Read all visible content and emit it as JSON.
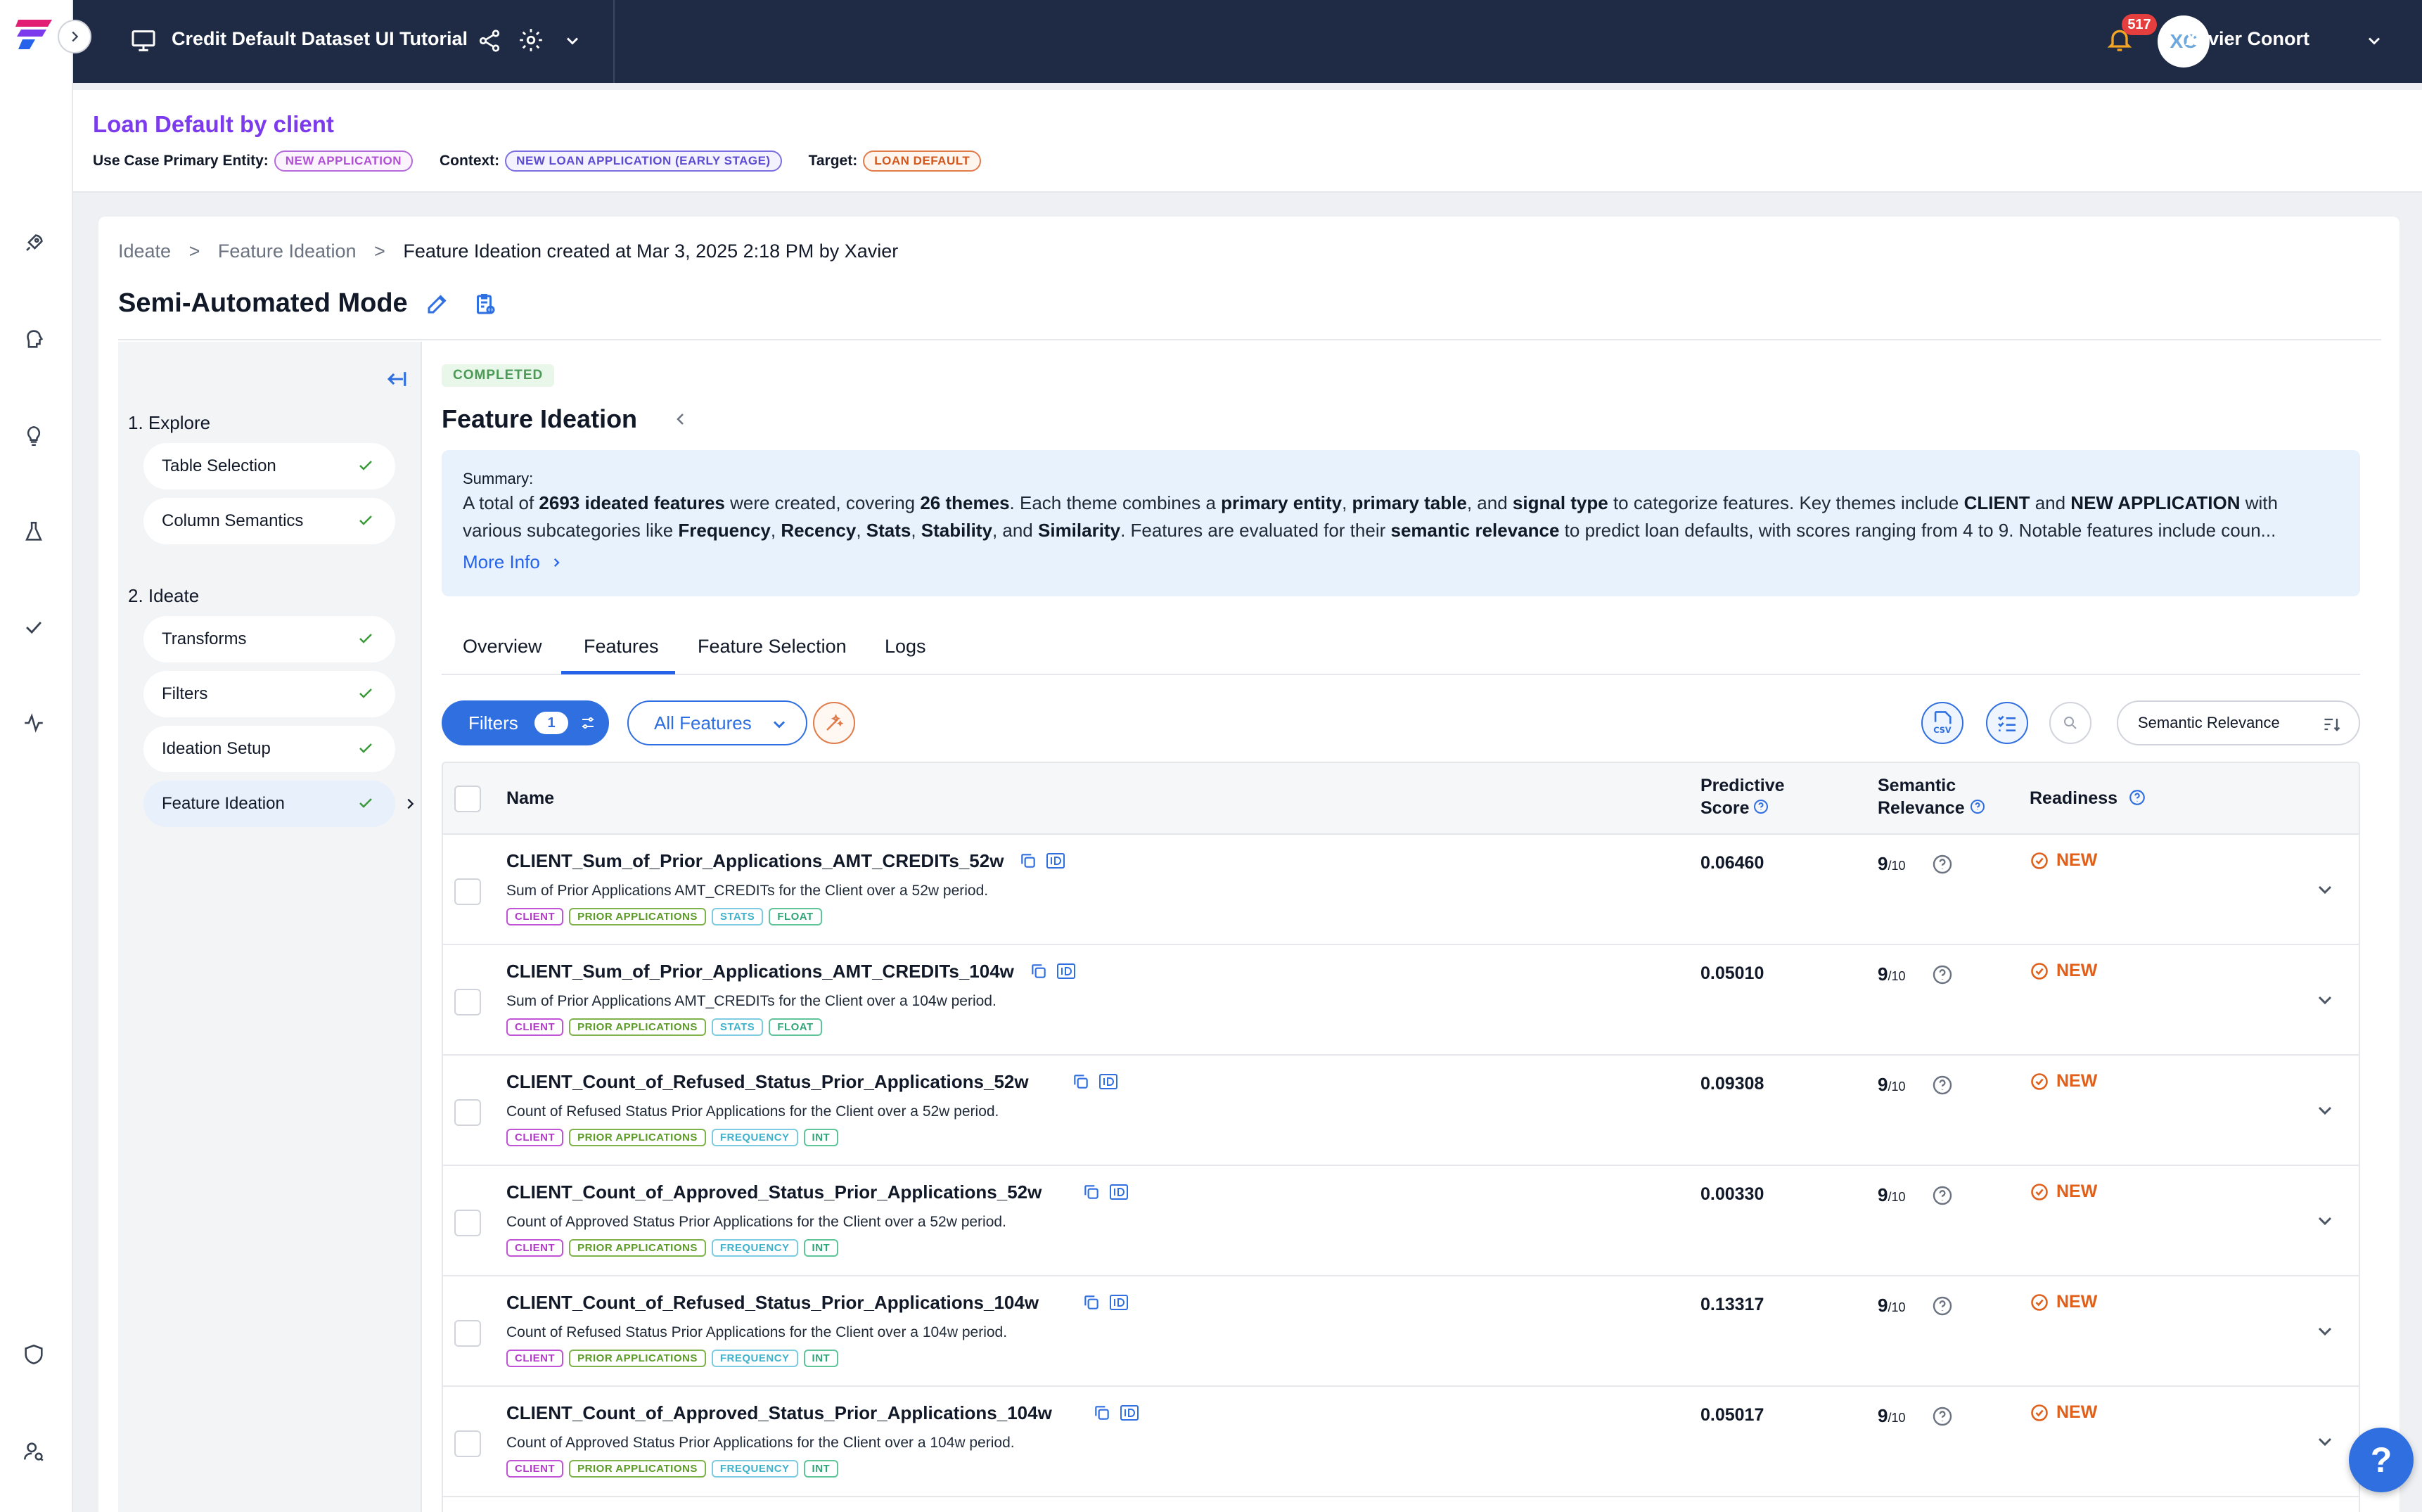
{
  "topbar": {
    "project_title": "Credit Default Dataset UI Tutorial",
    "notification_count": "517",
    "avatar_initials": "XC",
    "user_name": "Xavier Conort"
  },
  "use_case": {
    "title": "Loan Default by client",
    "entity_label": "Use Case Primary Entity:",
    "entity_value": "NEW APPLICATION",
    "context_label": "Context:",
    "context_value": "NEW LOAN APPLICATION (EARLY STAGE)",
    "target_label": "Target:",
    "target_value": "LOAN DEFAULT"
  },
  "breadcrumb": {
    "item1": "Ideate",
    "sep": ">",
    "item2": "Feature Ideation",
    "current": "Feature Ideation created at Mar 3, 2025 2:18 PM by Xavier"
  },
  "mode_title": "Semi-Automated Mode",
  "steps": {
    "explore_heading": "1. Explore",
    "ideate_heading": "2. Ideate",
    "items": [
      {
        "label": "Table Selection"
      },
      {
        "label": "Column Semantics"
      },
      {
        "label": "Transforms"
      },
      {
        "label": "Filters"
      },
      {
        "label": "Ideation Setup"
      },
      {
        "label": "Feature Ideation"
      }
    ]
  },
  "main": {
    "status": "COMPLETED",
    "title": "Feature Ideation",
    "summary_label": "Summary:",
    "summary": {
      "p1": "A total of ",
      "b1": "2693 ideated features",
      "p2": " were created, covering ",
      "b2": "26 themes",
      "p3": ". Each theme combines a ",
      "b3": "primary entity",
      "p4": ", ",
      "b4": "primary table",
      "p5": ", and ",
      "b5": "signal type",
      "p6": " to categorize features. Key themes include ",
      "b6": "CLIENT",
      "p7": " and ",
      "b7": "NEW APPLICATION",
      "p8": " with various subcategories like ",
      "b8": "Frequency",
      "p9": ", ",
      "b9": "Recency",
      "p10": ", ",
      "b10": "Stats",
      "p11": ", ",
      "b11": "Stability",
      "p12": ", and ",
      "b12": "Similarity",
      "p13": ". Features are evaluated for their ",
      "b13": "semantic relevance",
      "p14": " to predict loan defaults, with scores ranging from 4 to 9. Notable features include coun..."
    },
    "more_info": "More Info",
    "tabs": [
      "Overview",
      "Features",
      "Feature Selection",
      "Logs"
    ]
  },
  "toolbar": {
    "filters_label": "Filters",
    "filters_count": "1",
    "all_features": "All Features",
    "sort_label": "Semantic Relevance"
  },
  "table": {
    "headers": {
      "name": "Name",
      "predictive_1": "Predictive",
      "predictive_2": "Score",
      "semantic_1": "Semantic",
      "semantic_2": "Relevance",
      "readiness": "Readiness"
    },
    "rows": [
      {
        "name": "CLIENT_Sum_of_Prior_Applications_AMT_CREDITs_52w",
        "desc": "Sum of Prior Applications AMT_CREDITs for the Client over a 52w period.",
        "tags": [
          "CLIENT",
          "PRIOR APPLICATIONS",
          "STATS",
          "FLOAT"
        ],
        "score": "0.06460",
        "sem": "9",
        "sem_den": "/10",
        "ready": "NEW"
      },
      {
        "name": "CLIENT_Sum_of_Prior_Applications_AMT_CREDITs_104w",
        "desc": "Sum of Prior Applications AMT_CREDITs for the Client over a 104w period.",
        "tags": [
          "CLIENT",
          "PRIOR APPLICATIONS",
          "STATS",
          "FLOAT"
        ],
        "score": "0.05010",
        "sem": "9",
        "sem_den": "/10",
        "ready": "NEW"
      },
      {
        "name": "CLIENT_Count_of_Refused_Status_Prior_Applications_52w",
        "desc": "Count of Refused Status Prior Applications for the Client over a 52w period.",
        "tags": [
          "CLIENT",
          "PRIOR APPLICATIONS",
          "FREQUENCY",
          "INT"
        ],
        "score": "0.09308",
        "sem": "9",
        "sem_den": "/10",
        "ready": "NEW"
      },
      {
        "name": "CLIENT_Count_of_Approved_Status_Prior_Applications_52w",
        "desc": "Count of Approved Status Prior Applications for the Client over a 52w period.",
        "tags": [
          "CLIENT",
          "PRIOR APPLICATIONS",
          "FREQUENCY",
          "INT"
        ],
        "score": "0.00330",
        "sem": "9",
        "sem_den": "/10",
        "ready": "NEW"
      },
      {
        "name": "CLIENT_Count_of_Refused_Status_Prior_Applications_104w",
        "desc": "Count of Refused Status Prior Applications for the Client over a 104w period.",
        "tags": [
          "CLIENT",
          "PRIOR APPLICATIONS",
          "FREQUENCY",
          "INT"
        ],
        "score": "0.13317",
        "sem": "9",
        "sem_den": "/10",
        "ready": "NEW"
      },
      {
        "name": "CLIENT_Count_of_Approved_Status_Prior_Applications_104w",
        "desc": "Count of Approved Status Prior Applications for the Client over a 104w period.",
        "tags": [
          "CLIENT",
          "PRIOR APPLICATIONS",
          "FREQUENCY",
          "INT"
        ],
        "score": "0.05017",
        "sem": "9",
        "sem_den": "/10",
        "ready": "NEW"
      }
    ]
  },
  "help_fab": "?"
}
